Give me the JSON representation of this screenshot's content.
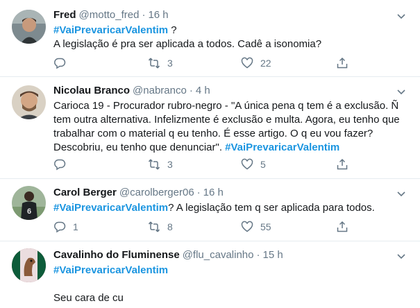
{
  "colors": {
    "accent": "#1b95e0",
    "muted": "#657786",
    "text": "#14171a",
    "divider": "#e6ecf0"
  },
  "tweets": [
    {
      "name": "Fred",
      "handle": "@motto_fred",
      "dot": "·",
      "time": "16 h",
      "text_parts": [
        {
          "text": "#VaiPrevaricarValentim",
          "tag": true
        },
        {
          "text": " ?",
          "tag": false
        },
        {
          "text": "A legislação é pra ser aplicada a todos. Cadê a isonomia?",
          "tag": false
        }
      ],
      "replies": "",
      "retweets": "3",
      "likes": "22",
      "icons": [
        "reply-icon",
        "retweet-icon",
        "like-icon",
        "share-icon"
      ]
    },
    {
      "name": "Nicolau Branco",
      "handle": "@nabranco",
      "dot": "·",
      "time": "4 h",
      "text_parts": [
        {
          "text": "Carioca 19 - Procurador rubro-negro - \"A única pena q tem é a exclusão. Ñ tem outra alternativa. Infelizmente é exclusão e multa. Agora, eu tenho que trabalhar com o material q eu tenho. É esse artigo. O q eu vou fazer? Descobriu, eu tenho que denunciar\". ",
          "tag": false
        },
        {
          "text": "#VaiPrevaricarValentim",
          "tag": true
        }
      ],
      "replies": "",
      "retweets": "3",
      "likes": "5",
      "icons": [
        "reply-icon",
        "retweet-icon",
        "like-icon",
        "share-icon"
      ]
    },
    {
      "name": "Carol Berger",
      "handle": "@carolberger06",
      "dot": "·",
      "time": "16 h",
      "text_parts": [
        {
          "text": "#VaiPrevaricarValentim",
          "tag": true
        },
        {
          "text": "? A legislação tem q ser aplicada para todos.",
          "tag": false
        }
      ],
      "replies": "1",
      "retweets": "8",
      "likes": "55",
      "icons": [
        "reply-icon",
        "retweet-icon",
        "like-icon",
        "share-icon"
      ]
    },
    {
      "name": "Cavalinho do Fluminense",
      "handle": "@flu_cavalinho",
      "dot": "·",
      "time": "15 h",
      "text_parts": [
        {
          "text": "#VaiPrevaricarValentim",
          "tag": true
        }
      ],
      "second_text": "Seu cara de cu"
    }
  ]
}
